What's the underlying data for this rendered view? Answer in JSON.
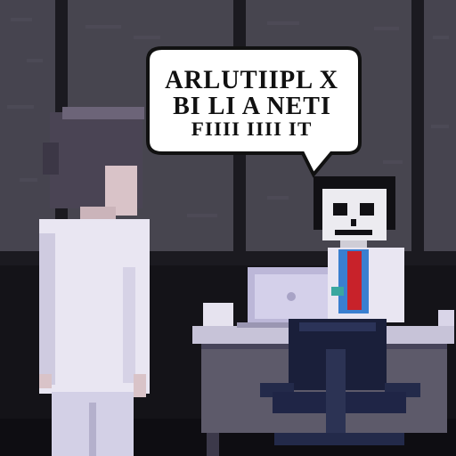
{
  "speech_bubble": {
    "lines": [
      "ARLUTIIPL X",
      "BI LI A NETI",
      "FIIII IIII IT"
    ]
  },
  "colors": {
    "wall": "#3e3c47",
    "window_frame": "#1b1a20",
    "floor": "#141318",
    "desk": "#5d5a6a",
    "coat": "#e9e6f2",
    "laptop": "#bcb7d8",
    "tie": "#c8222a",
    "chair": "#1a1f3a"
  }
}
